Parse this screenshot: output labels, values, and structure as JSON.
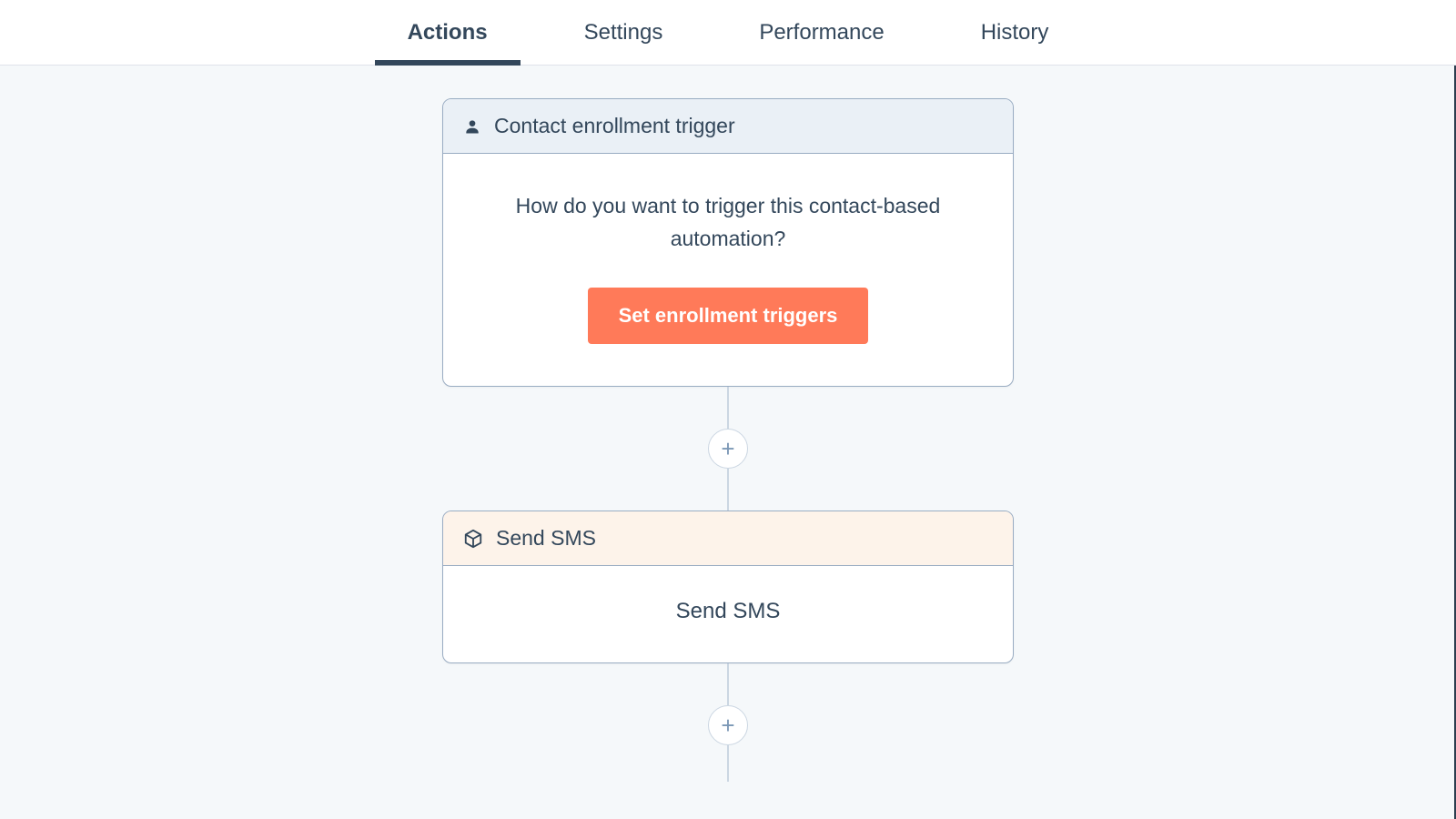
{
  "tabs": [
    {
      "label": "Actions",
      "active": true
    },
    {
      "label": "Settings",
      "active": false
    },
    {
      "label": "Performance",
      "active": false
    },
    {
      "label": "History",
      "active": false
    }
  ],
  "trigger_card": {
    "header": "Contact enrollment trigger",
    "prompt": "How do you want to trigger this contact-based automation?",
    "button": "Set enrollment triggers"
  },
  "action_card": {
    "header": "Send SMS",
    "body": "Send SMS"
  },
  "add_label": "+"
}
